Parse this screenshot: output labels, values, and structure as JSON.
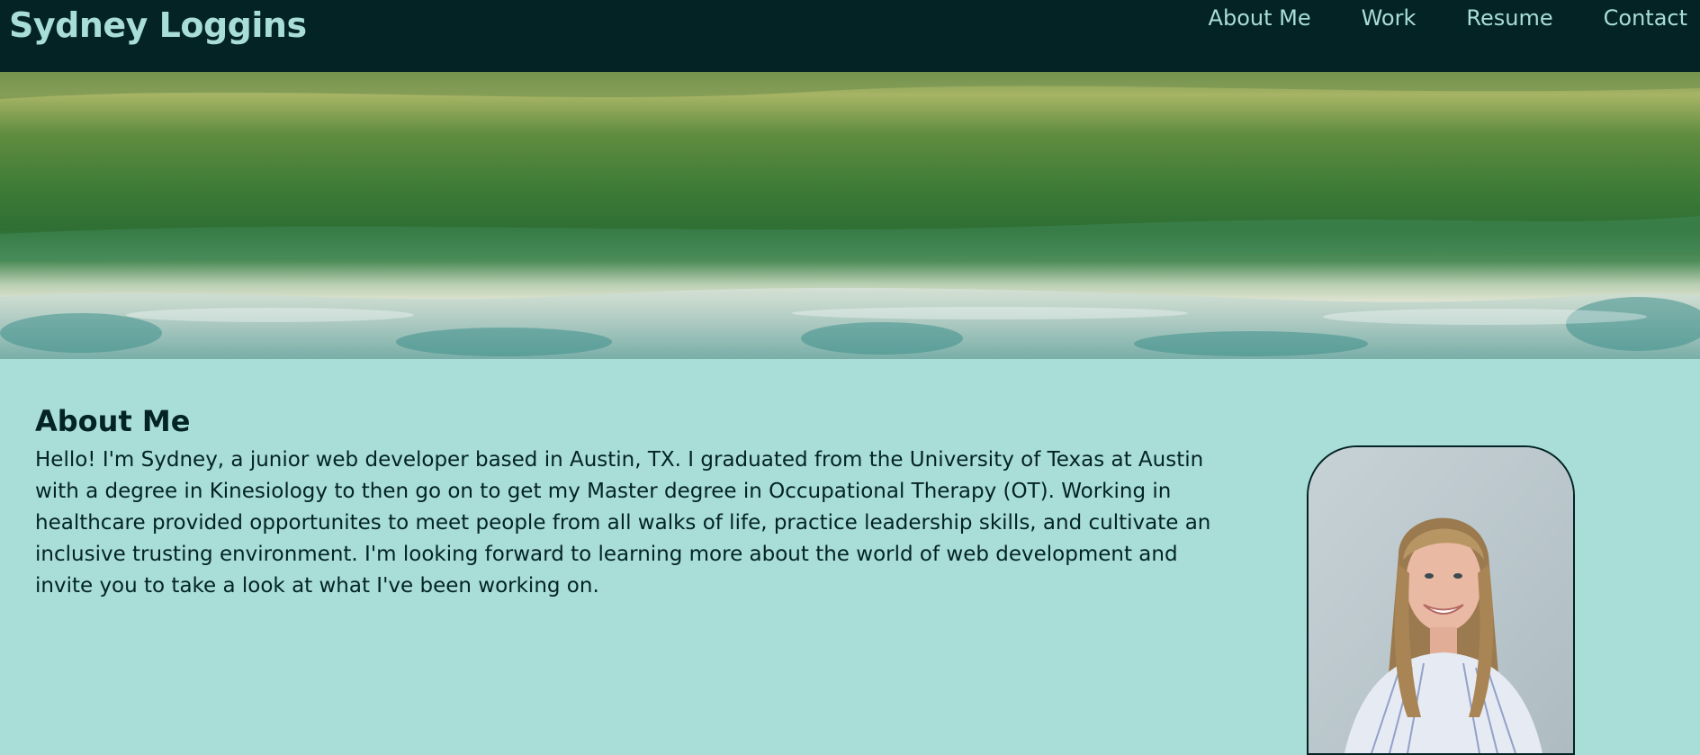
{
  "header": {
    "site_title": "Sydney Loggins",
    "nav": [
      {
        "label": "About Me"
      },
      {
        "label": "Work"
      },
      {
        "label": "Resume"
      },
      {
        "label": "Contact"
      }
    ]
  },
  "hero": {
    "image": "ocean-wave-photo"
  },
  "about": {
    "heading": "About Me",
    "body": "Hello! I'm Sydney, a junior web developer based in Austin, TX. I graduated from the University of Texas at Austin with a degree in Kinesiology to then go on to get my Master degree in Occupational Therapy (OT). Working in healthcare provided opportunites to meet people from all walks of life, practice leadership skills, and cultivate an inclusive trusting environment. I'm looking forward to learning more about the world of web development and invite you to take a look at what I've been working on.",
    "portrait_image": "portrait-photo"
  },
  "colors": {
    "header_bg": "#032325",
    "accent": "#a9ddd7",
    "text": "#032325"
  }
}
